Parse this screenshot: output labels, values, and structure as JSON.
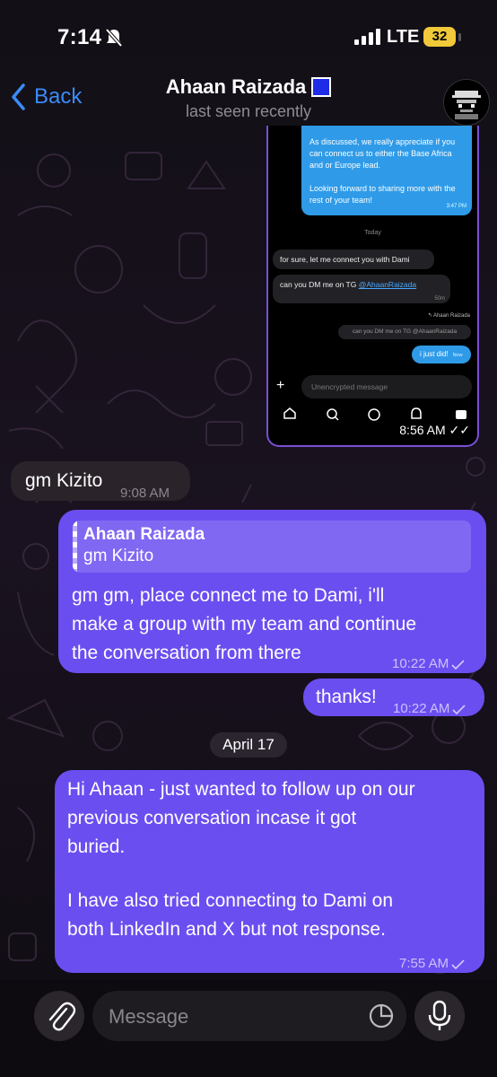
{
  "status_bar": {
    "time": "7:14",
    "network": "LTE",
    "battery": "32"
  },
  "header": {
    "back_label": "Back",
    "contact_name": "Ahaan Raizada",
    "status": "last seen recently"
  },
  "embedded_screenshot": {
    "blue_message": "As discussed, we really appreciate if you can connect us to either the Base Africa and or Europe lead.\n\nLooking forward to sharing more with the rest of your team!",
    "blue_time": "3:47 PM",
    "day_label": "Today",
    "msg1": "for sure, let me connect you with Dami",
    "msg2_prefix": "can you DM me on TG ",
    "msg2_handle": "@AhaanRaizada",
    "msg2_time": "50m",
    "reply_name": "Ahaan Raizada",
    "reply_quote": "can you DM me on TG @AhaanRaizada",
    "my_msg": "i just did!",
    "my_msg_time": "Now",
    "input_placeholder": "Unencrypted message",
    "stamp": "8:56 AM"
  },
  "messages": [
    {
      "text": "gm Kizito",
      "time": "9:08 AM"
    },
    {
      "reply_name": "Ahaan Raizada",
      "reply_text": "gm Kizito",
      "line1": "gm gm, place connect me to Dami, i'll",
      "line2": "make a group with my team and continue",
      "line3": "the conversation from there",
      "time": "10:22 AM"
    },
    {
      "text": "thanks!",
      "time": "10:22 AM"
    },
    {
      "line1": "Hi Ahaan - just wanted to follow up on our",
      "line2": "previous conversation incase it got",
      "line3": "buried.",
      "line4": "I have also tried connecting to Dami on",
      "line5": "both LinkedIn and X but not response.",
      "time": "7:55 AM"
    }
  ],
  "date_divider": "April 17",
  "input": {
    "placeholder": "Message"
  },
  "colors": {
    "accent": "#3a8cf7",
    "outgoing_bubble": "#6b4ef0",
    "incoming_bubble": "#2a2329"
  }
}
